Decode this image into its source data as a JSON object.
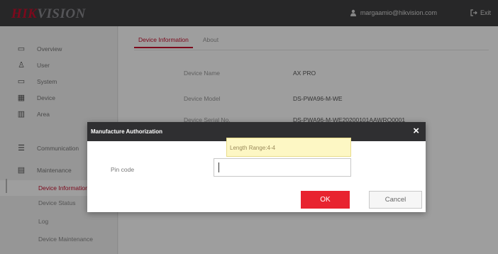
{
  "header": {
    "logo_part1": "HIK",
    "logo_part2": "VISION",
    "user_email": "margaamio@hikvision.com",
    "exit_label": "Exit",
    "user_icon": "user-icon",
    "exit_icon": "exit-icon"
  },
  "sidebar": {
    "items": [
      {
        "label": "Overview",
        "icon": "monitor-icon"
      },
      {
        "label": "User",
        "icon": "user-icon"
      },
      {
        "label": "System",
        "icon": "system-icon"
      },
      {
        "label": "Device",
        "icon": "device-icon"
      },
      {
        "label": "Area",
        "icon": "area-icon"
      },
      {
        "label": "Communication",
        "icon": "communication-icon"
      },
      {
        "label": "Maintenance",
        "icon": "maintenance-icon"
      }
    ],
    "subitems": [
      {
        "label": "Device Information",
        "active": true
      },
      {
        "label": "Device Status",
        "active": false
      },
      {
        "label": "Log",
        "active": false
      },
      {
        "label": "Device Maintenance",
        "active": false
      }
    ]
  },
  "main": {
    "tabs": [
      {
        "label": "Device Information",
        "active": true
      },
      {
        "label": "About",
        "active": false
      }
    ],
    "info": [
      {
        "label": "Device Name",
        "value": "AX PRO"
      },
      {
        "label": "Device Model",
        "value": "DS-PWA96-M-WE"
      },
      {
        "label": "Device Serial No.",
        "value": "DS-PWA96-M-WE20200101AAWRQ0001"
      }
    ]
  },
  "modal": {
    "title": "Manufacture Authorization",
    "tooltip": "Length Range:4-4",
    "pin_label": "Pin code",
    "pin_value": "",
    "ok_label": "OK",
    "cancel_label": "Cancel",
    "close_symbol": "×"
  },
  "colors": {
    "accent": "#c8102e",
    "ok_button": "#e8232f",
    "header_bg": "#3f3f41",
    "modal_header_bg": "#2f2f31",
    "tooltip_bg": "#fdf7c4"
  }
}
